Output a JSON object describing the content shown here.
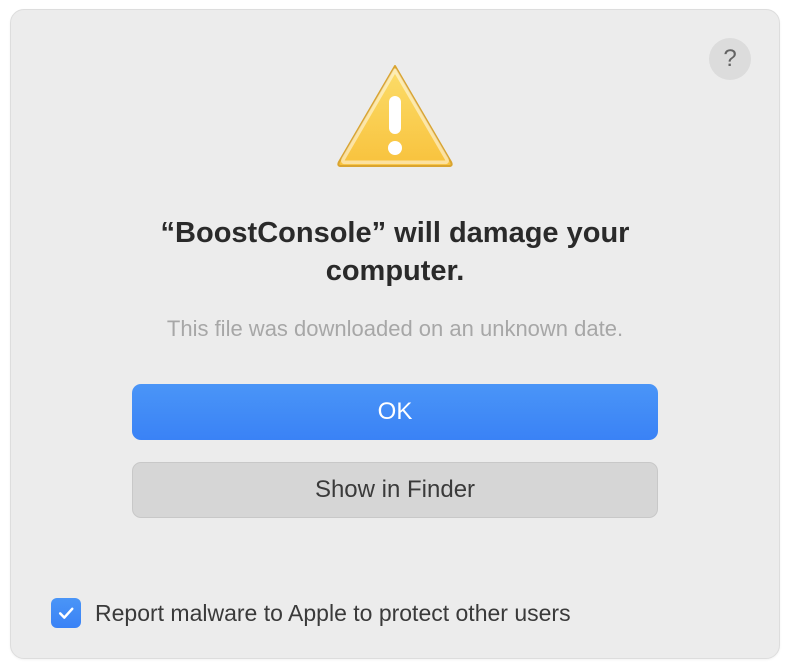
{
  "dialog": {
    "title": "“BoostConsole” will damage your computer.",
    "subtitle": "This file was downloaded on an unknown date.",
    "help_label": "?",
    "buttons": {
      "primary": "OK",
      "secondary": "Show in Finder"
    },
    "checkbox": {
      "checked": true,
      "label": "Report malware to Apple to protect other users"
    }
  },
  "icons": {
    "warning": "warning-triangle",
    "help": "help-circle",
    "checkmark": "checkmark"
  }
}
